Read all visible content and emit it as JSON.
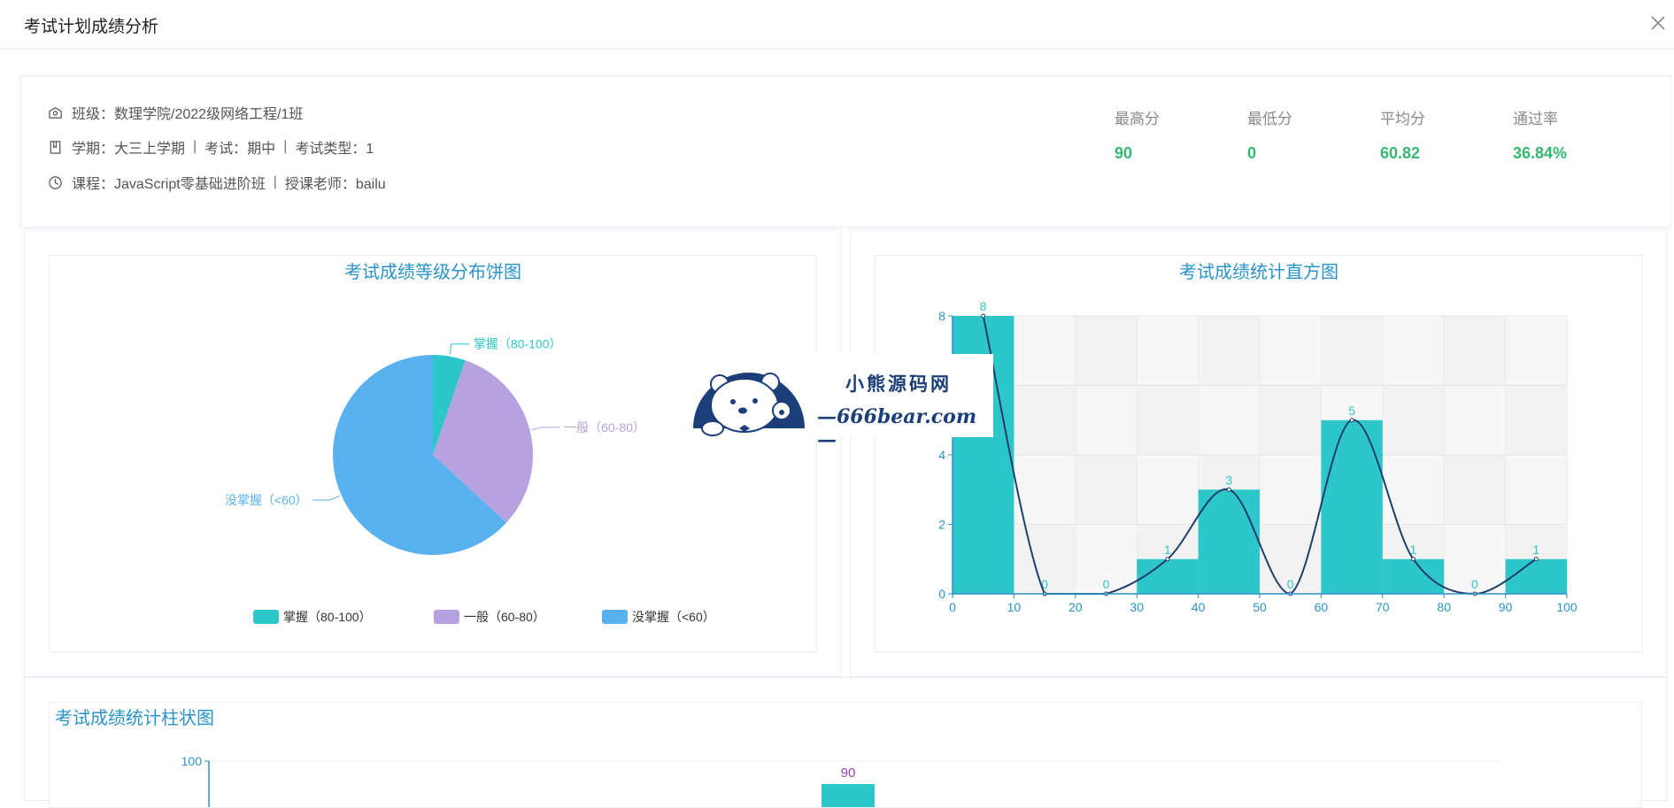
{
  "modal": {
    "title": "考试计划成绩分析"
  },
  "info": {
    "class_line": "班级：数理学院/2022级网络工程/1班",
    "term_line": "学期：大三上学期",
    "exam_line": "考试：期中",
    "exam_type_line": "考试类型：1",
    "course_line": "课程：JavaScript零基础进阶班",
    "teacher_line": "授课老师：bailu",
    "separator": "|"
  },
  "stats": [
    {
      "label": "最高分",
      "value": "90"
    },
    {
      "label": "最低分",
      "value": "0"
    },
    {
      "label": "平均分",
      "value": "60.82"
    },
    {
      "label": "通过率",
      "value": "36.84%"
    }
  ],
  "watermark": {
    "title": "小熊源码网",
    "url": "—666bear.com—"
  },
  "colors": {
    "accent": "#2a93c9",
    "stat_green": "#34b870",
    "teal": "#2ec7c9",
    "purple": "#b6a2de",
    "blue": "#5ab1ef",
    "curve": "#1f3f6b",
    "navy": "#1d3f79"
  },
  "chart_data": [
    {
      "type": "pie",
      "title": "考试成绩等级分布饼图",
      "slices": [
        {
          "name": "掌握（80-100）",
          "value": 1,
          "color": "#2ec7c9"
        },
        {
          "name": "一般（60-80）",
          "value": 6,
          "color": "#b6a2de"
        },
        {
          "name": "没掌握（<60）",
          "value": 12,
          "color": "#5ab1ef"
        }
      ],
      "legend": [
        "掌握（80-100）",
        "一般（60-80）",
        "没掌握（<60）"
      ],
      "legend_placement": "bottom"
    },
    {
      "type": "bar",
      "title": "考试成绩统计直方图",
      "x_ticks": [
        "0",
        "10",
        "20",
        "30",
        "40",
        "50",
        "60",
        "70",
        "80",
        "90",
        "100"
      ],
      "y_ticks": [
        "0",
        "2",
        "4",
        "6",
        "8"
      ],
      "xlim": [
        0,
        100
      ],
      "ylim": [
        0,
        8
      ],
      "bins": [
        {
          "x": 5,
          "value": 8
        },
        {
          "x": 15,
          "value": 0
        },
        {
          "x": 25,
          "value": 0
        },
        {
          "x": 35,
          "value": 1
        },
        {
          "x": 45,
          "value": 3
        },
        {
          "x": 55,
          "value": 0
        },
        {
          "x": 65,
          "value": 5
        },
        {
          "x": 75,
          "value": 1
        },
        {
          "x": 85,
          "value": 0
        },
        {
          "x": 95,
          "value": 1
        }
      ],
      "smooth_line": true,
      "grid": "alternating bands"
    },
    {
      "type": "bar",
      "title": "考试成绩统计柱状图",
      "y_ticks": [
        "100"
      ],
      "visible_labels": [
        "90"
      ]
    }
  ]
}
